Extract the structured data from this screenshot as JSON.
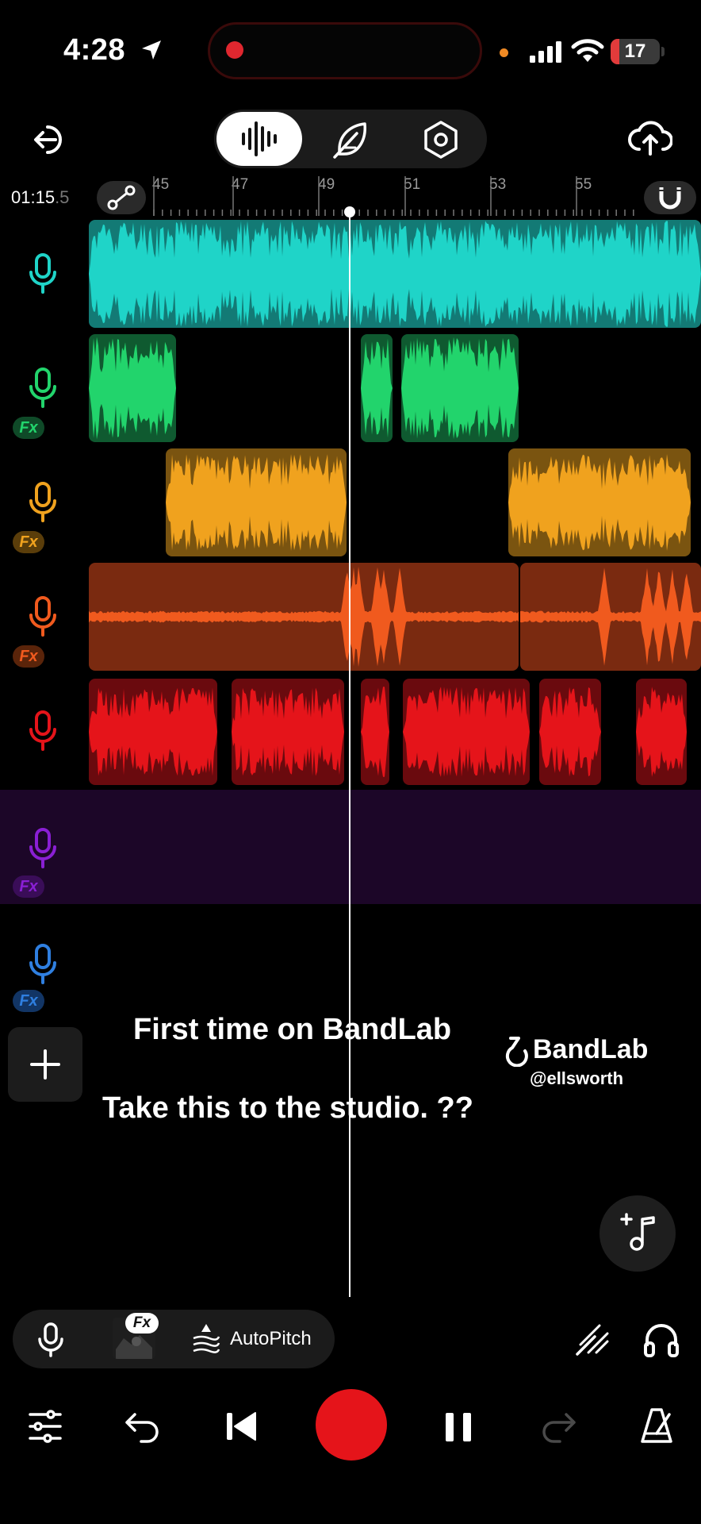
{
  "status_bar": {
    "time": "4:28",
    "battery": "17",
    "battery_level": 0.17,
    "icons": [
      "location-arrow-icon",
      "cellular-signal-icon",
      "wifi-icon",
      "battery-icon"
    ]
  },
  "toolbar": {
    "modes": [
      "waveform-icon",
      "feather-icon",
      "hexagon-settings-icon"
    ],
    "selected_mode": "waveform-icon",
    "left_icon": "exit-icon",
    "right_icon": "cloud-upload-icon"
  },
  "timeline": {
    "timecode_main": "01:15",
    "timecode_fraction": ".5",
    "bar_numbers": [
      "45",
      "47",
      "49",
      "51",
      "53",
      "55"
    ]
  },
  "tracks": [
    {
      "name": "track-1",
      "color": "#1fd4c8",
      "fx": false
    },
    {
      "name": "track-2",
      "color": "#22d46c",
      "fx": true,
      "fx_label": "Fx"
    },
    {
      "name": "track-3",
      "color": "#f0a21e",
      "fx": true,
      "fx_label": "Fx"
    },
    {
      "name": "track-4",
      "color": "#f05a1e",
      "fx": true,
      "fx_label": "Fx"
    },
    {
      "name": "track-5",
      "color": "#e5141a",
      "fx": false
    },
    {
      "name": "track-6",
      "color": "#8a1fd4",
      "fx": true,
      "fx_label": "Fx",
      "selected": true
    },
    {
      "name": "track-7",
      "color": "#2f7fe0",
      "fx": true,
      "fx_label": "Fx"
    }
  ],
  "overlay": {
    "line1": "First time on BandLab",
    "line2": "Take this to the studio. ??"
  },
  "watermark": {
    "brand": "BandLab",
    "user": "@ellsworth"
  },
  "bottom_tools": {
    "fx_label": "Fx",
    "autopitch_label": "AutoPitch"
  },
  "transport": {
    "icons": [
      "mixer-icon",
      "undo-icon",
      "skip-back-icon",
      "record-icon",
      "pause-icon",
      "redo-icon",
      "metronome-icon"
    ],
    "record_color": "#e5141a"
  }
}
